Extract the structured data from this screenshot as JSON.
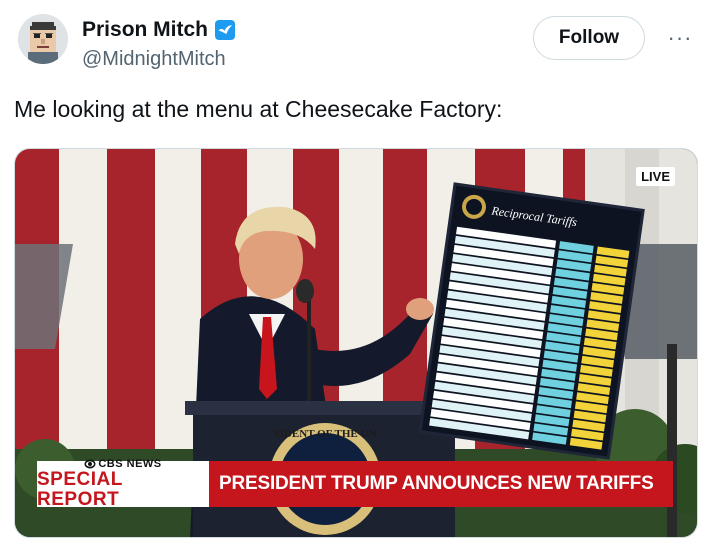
{
  "author": {
    "display_name": "Prison Mitch",
    "handle": "@MidnightMitch",
    "verified": true,
    "avatar_icon": "pixel-portrait-avatar"
  },
  "actions": {
    "follow_label": "Follow",
    "more_label": "···"
  },
  "tweet": {
    "text": "Me looking at the menu at Cheesecake Factory:"
  },
  "media": {
    "live_badge": "LIVE",
    "network": "CBS NEWS",
    "segment": "SPECIAL REPORT",
    "headline": "PRESIDENT TRUMP ANNOUNCES NEW TARIFFS",
    "board_title": "Reciprocal Tariffs",
    "seal_text": "SIDENT OF THE UN",
    "colors": {
      "chyron_red": "#c4161c",
      "board_blue": "#6fd0e0",
      "board_yellow": "#f3d33a",
      "verified_blue": "#1d9bf0"
    }
  }
}
